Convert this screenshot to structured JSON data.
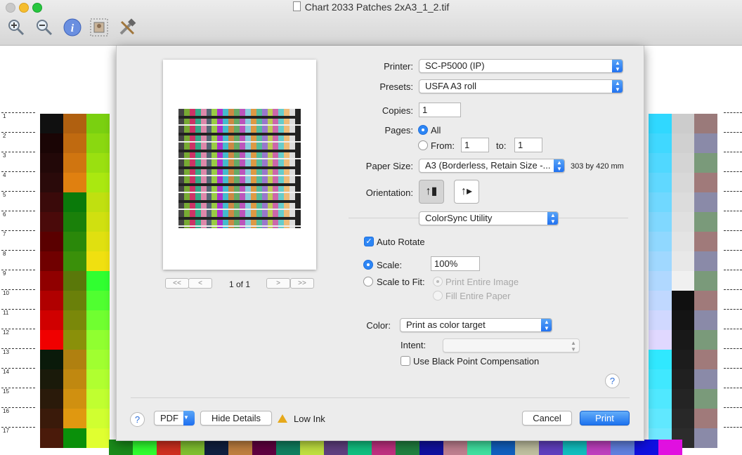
{
  "window": {
    "title": "Chart 2033 Patches 2xA3_1_2.tif",
    "toolbar": [
      "zoom-in-icon",
      "zoom-out-icon",
      "info-icon",
      "image-icon",
      "tools-icon"
    ]
  },
  "background": {
    "row_labels": [
      "1",
      "2",
      "3",
      "4",
      "5",
      "6",
      "7",
      "8",
      "9",
      "10",
      "11",
      "12",
      "13",
      "14",
      "15",
      "16",
      "17"
    ]
  },
  "preview": {
    "page_indicator": "1 of 1",
    "nav_first": "<<",
    "nav_prev": "<",
    "nav_next": ">",
    "nav_last": ">>"
  },
  "form": {
    "printer_label": "Printer:",
    "printer_value": "SC-P5000 (IP)",
    "presets_label": "Presets:",
    "presets_value": "USFA A3 roll",
    "copies_label": "Copies:",
    "copies_value": "1",
    "pages_label": "Pages:",
    "pages_all": "All",
    "pages_from_label": "From:",
    "pages_from_value": "1",
    "pages_to_label": "to:",
    "pages_to_value": "1",
    "paper_size_label": "Paper Size:",
    "paper_size_value": "A3 (Borderless, Retain Size -...",
    "paper_size_dims": "303 by 420 mm",
    "orientation_label": "Orientation:",
    "section_popup": "ColorSync Utility",
    "auto_rotate": "Auto Rotate",
    "scale_label": "Scale:",
    "scale_value": "100%",
    "scale_to_fit": "Scale to Fit:",
    "print_entire_image": "Print Entire Image",
    "fill_entire_paper": "Fill Entire Paper",
    "color_label": "Color:",
    "color_value": "Print as color target",
    "intent_label": "Intent:",
    "intent_value": "",
    "black_point": "Use Black Point Compensation"
  },
  "footer": {
    "help": "?",
    "pdf": "PDF",
    "hide_details": "Hide Details",
    "low_ink": "Low Ink",
    "cancel": "Cancel",
    "print": "Print"
  }
}
